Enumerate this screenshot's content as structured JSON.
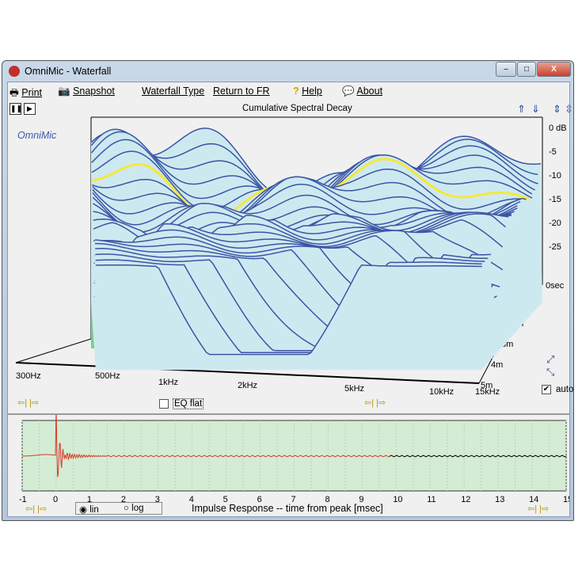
{
  "window": {
    "title": "OmniMic - Waterfall",
    "minimize": "–",
    "maximize": "□",
    "close": "X"
  },
  "menu": {
    "print": "Print",
    "snapshot": "Snapshot",
    "waterfall_type": "Waterfall Type",
    "return_fr": "Return to FR",
    "help": "Help",
    "about": "About"
  },
  "waterfall": {
    "title": "Cumulative Spectral Decay",
    "brand": "OmniMic",
    "db_ticks": [
      "0 dB",
      "-5",
      "-10",
      "-15",
      "-20",
      "-25"
    ],
    "time_ticks": [
      "0sec",
      "1m",
      "2m",
      "3m",
      "4m",
      "5m"
    ],
    "freq_ticks": [
      "300Hz",
      "500Hz",
      "1kHz",
      "2kHz",
      "5kHz",
      "10kHz",
      "15kHz"
    ],
    "eq_flat": "EQ flat",
    "eq_flat_checked": false,
    "auto": "auto",
    "auto_checked": true,
    "colors": {
      "fill": "#cde9f0",
      "stroke": "#3b54a4",
      "highlight": "#f5e83a",
      "wall": "#7ccc8e"
    }
  },
  "impulse": {
    "xlabel": "Impulse Response  -- time from peak [msec]",
    "x_ticks": [
      "-1",
      "0",
      "1",
      "2",
      "3",
      "4",
      "5",
      "6",
      "7",
      "8",
      "9",
      "10",
      "11",
      "12",
      "13",
      "14",
      "15"
    ],
    "xlim": [
      -1,
      15
    ],
    "mode_lin": "lin",
    "mode_log": "log",
    "selected": "lin",
    "colors": {
      "bg": "#d4ecd4",
      "windowed": "#d63a2a",
      "rest": "#000000"
    }
  }
}
